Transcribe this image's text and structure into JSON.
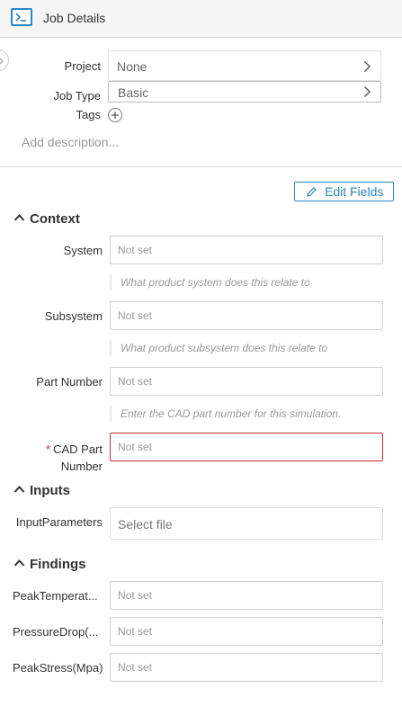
{
  "header": {
    "title": "Job Details",
    "icon": "terminal-icon"
  },
  "job": {
    "project_label": "Project",
    "project_value": "None",
    "job_type_label": "Job Type",
    "job_type_value": "Basic",
    "tags_label": "Tags",
    "add_description": "Add description..."
  },
  "toolbar": {
    "edit_fields_label": "Edit Fields"
  },
  "sections": {
    "context": {
      "title": "Context"
    },
    "inputs": {
      "title": "Inputs"
    },
    "findings": {
      "title": "Findings"
    }
  },
  "context_fields": [
    {
      "label": "System",
      "placeholder": "Not set",
      "help": "What product system does this relate to"
    },
    {
      "label": "Subsystem",
      "placeholder": "Not set",
      "help": "What product subsystem does this relate to"
    },
    {
      "label": "Part Number",
      "placeholder": "Not set",
      "help": "Enter the CAD part number for this simulation."
    },
    {
      "label_line1": "CAD Part",
      "label_line2": "Number",
      "required_mark": "*",
      "placeholder": "Not set"
    }
  ],
  "input_fields": [
    {
      "label": "InputParameters",
      "placeholder": "Select file"
    }
  ],
  "finding_fields": [
    {
      "label": "PeakTemperat...",
      "placeholder": "Not set"
    },
    {
      "label": "PressureDrop(...",
      "placeholder": "Not set"
    },
    {
      "label": "PeakStress(Mpa)",
      "placeholder": "Not set"
    }
  ],
  "colors": {
    "accent": "#2b86c5",
    "error": "#c9302c",
    "header_bg": "#f5f5f5"
  }
}
